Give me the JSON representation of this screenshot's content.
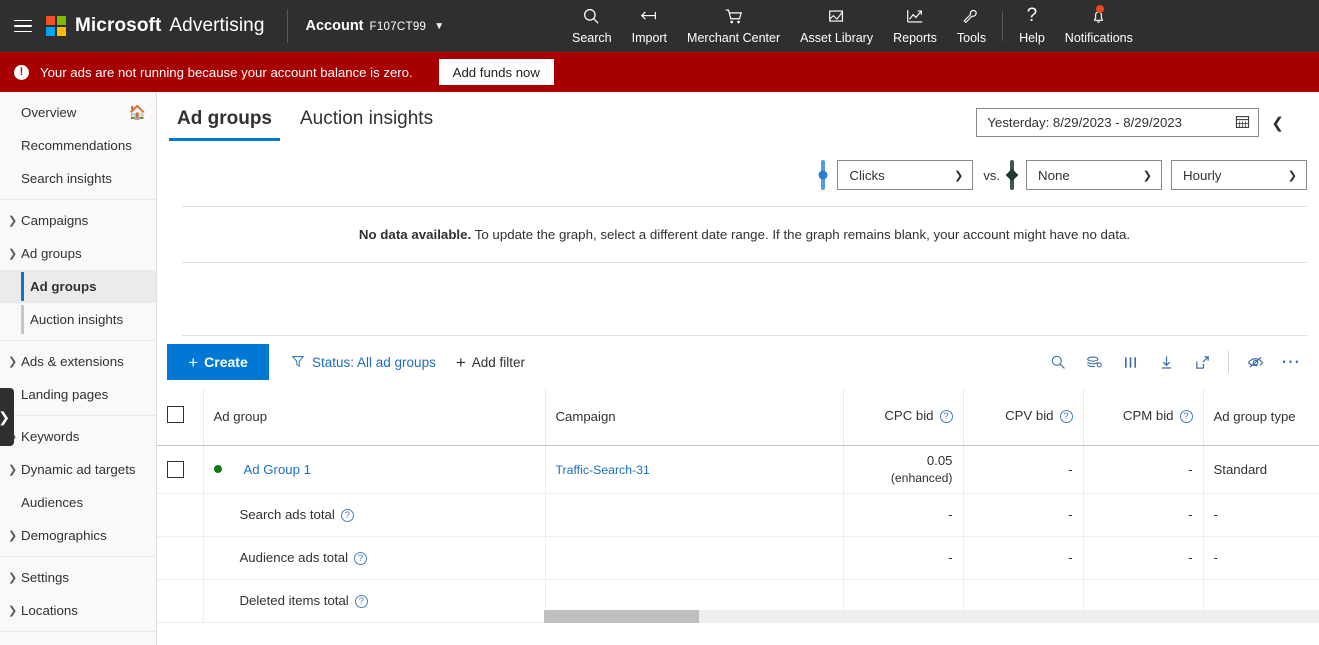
{
  "header": {
    "menu_icon": "hamburger-icon",
    "brand_microsoft": "Microsoft",
    "brand_product": "Advertising",
    "account_label": "Account",
    "account_value": "F107CT99",
    "nav": [
      {
        "label": "Search",
        "icon": "search-icon"
      },
      {
        "label": "Import",
        "icon": "import-arrow-icon"
      },
      {
        "label": "Merchant Center",
        "icon": "shopping-cart-icon"
      },
      {
        "label": "Asset Library",
        "icon": "image-edit-icon"
      },
      {
        "label": "Reports",
        "icon": "line-chart-icon"
      },
      {
        "label": "Tools",
        "icon": "wrench-icon"
      },
      {
        "label": "Help",
        "icon": "question-mark-icon"
      },
      {
        "label": "Notifications",
        "icon": "bell-icon"
      }
    ]
  },
  "alert": {
    "icon": "exclamation-icon",
    "message": "Your ads are not running because your account balance is zero.",
    "button": "Add funds now",
    "bg_color": "#a80000"
  },
  "sidebar": {
    "collapse_icon": "chevron-right-icon",
    "sections": [
      {
        "items": [
          {
            "label": "Overview",
            "type": "leaf",
            "trailing_icon": "home-icon"
          },
          {
            "label": "Recommendations",
            "type": "leaf"
          },
          {
            "label": "Search insights",
            "type": "leaf"
          }
        ]
      },
      {
        "items": [
          {
            "label": "Campaigns",
            "type": "expandable",
            "expanded": false
          },
          {
            "label": "Ad groups",
            "type": "expandable",
            "expanded": true
          },
          {
            "label": "Ad groups",
            "type": "child",
            "active": true
          },
          {
            "label": "Auction insights",
            "type": "child",
            "active": false
          }
        ]
      },
      {
        "items": [
          {
            "label": "Ads & extensions",
            "type": "expandable",
            "expanded": false
          },
          {
            "label": "Landing pages",
            "type": "leaf"
          }
        ]
      },
      {
        "items": [
          {
            "label": "Keywords",
            "type": "expandable",
            "expanded": false
          },
          {
            "label": "Dynamic ad targets",
            "type": "expandable",
            "expanded": false
          },
          {
            "label": "Audiences",
            "type": "leaf"
          },
          {
            "label": "Demographics",
            "type": "expandable",
            "expanded": false
          }
        ]
      },
      {
        "items": [
          {
            "label": "Settings",
            "type": "expandable",
            "expanded": false
          },
          {
            "label": "Locations",
            "type": "expandable",
            "expanded": false
          }
        ]
      }
    ]
  },
  "page": {
    "tabs": [
      {
        "label": "Ad groups",
        "active": true
      },
      {
        "label": "Auction insights",
        "active": false
      }
    ],
    "date_range": {
      "value": "Yesterday: 8/29/2023 - 8/29/2023",
      "calendar_icon": "calendar-icon",
      "prev_icon": "chevron-left-icon"
    }
  },
  "chart": {
    "primary_metric": "Clicks",
    "vs_label": "vs.",
    "secondary_metric": "None",
    "granularity": "Hourly",
    "empty_bold": "No data available.",
    "empty_rest": " To update the graph, select a different date range. If the graph remains blank, your account might have no data."
  },
  "toolbar": {
    "create_label": "Create",
    "status_filter": "Status: All ad groups",
    "add_filter": "Add filter",
    "icons": [
      "search-icon",
      "segment-layers-icon",
      "columns-icon",
      "download-icon",
      "expand-icon",
      "hide-eye-icon",
      "more-ellipsis-icon"
    ]
  },
  "table": {
    "select_all_checkbox": "unchecked",
    "columns": [
      {
        "label": "Ad group",
        "align": "left",
        "help": false
      },
      {
        "label": "Campaign",
        "align": "left",
        "help": false
      },
      {
        "label": "CPC bid",
        "align": "right",
        "help": true
      },
      {
        "label": "CPV bid",
        "align": "right",
        "help": true
      },
      {
        "label": "CPM bid",
        "align": "right",
        "help": true
      },
      {
        "label": "Ad group type",
        "align": "left",
        "help": false
      }
    ],
    "rows": [
      {
        "kind": "entity",
        "status": "enabled",
        "ad_group": "Ad Group 1",
        "campaign": "Traffic-Search-31",
        "cpc_bid": "0.05",
        "cpc_bid_note": "(enhanced)",
        "cpv_bid": "-",
        "cpm_bid": "-",
        "ad_group_type": "Standard"
      },
      {
        "kind": "total",
        "ad_group": "Search ads total",
        "help": true,
        "campaign": "",
        "cpc_bid": "-",
        "cpv_bid": "-",
        "cpm_bid": "-",
        "ad_group_type": "-"
      },
      {
        "kind": "total",
        "ad_group": "Audience ads total",
        "help": true,
        "campaign": "",
        "cpc_bid": "-",
        "cpv_bid": "-",
        "cpm_bid": "-",
        "ad_group_type": "-"
      },
      {
        "kind": "total",
        "ad_group": "Deleted items total",
        "help": true,
        "campaign": "",
        "cpc_bid": "",
        "cpv_bid": "",
        "cpm_bid": "",
        "ad_group_type": ""
      }
    ]
  },
  "colors": {
    "accent": "#0078d4",
    "link": "#1a6ec1",
    "alert": "#a80000",
    "status_enabled": "#107c10",
    "header_bg": "#2f2f2f"
  }
}
